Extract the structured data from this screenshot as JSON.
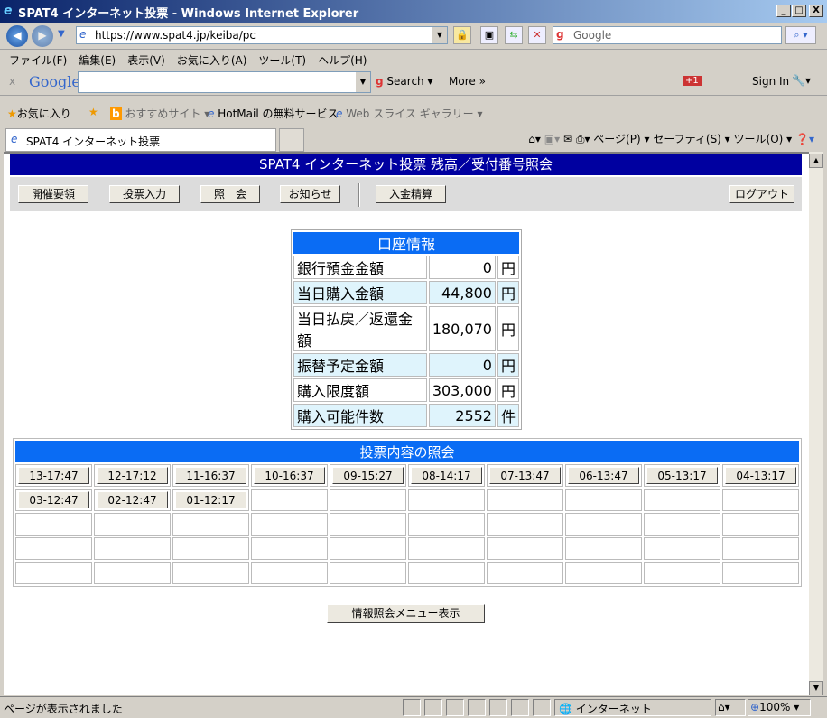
{
  "window": {
    "title": "SPAT4 インターネット投票 - Windows Internet Explorer",
    "minimize": "_",
    "maximize": "□",
    "close": "X"
  },
  "nav": {
    "url": "https://www.spat4.jp/keiba/pc",
    "search_placeholder": "Google"
  },
  "menu": [
    "ファイル(F)",
    "編集(E)",
    "表示(V)",
    "お気に入り(A)",
    "ツール(T)",
    "ヘルプ(H)"
  ],
  "google_bar": {
    "close": "x",
    "logo": "Google",
    "search": "Search",
    "more": "More »",
    "gplus": "+1",
    "sign_in": "Sign In"
  },
  "favorites": {
    "label": "お気に入り",
    "items": [
      "おすすめサイト ▾",
      "HotMail の無料サービス",
      "Web スライス ギャラリー ▾"
    ]
  },
  "tab": {
    "title": "SPAT4 インターネット投票"
  },
  "commands": {
    "page": "ページ(P) ▾",
    "safety": "セーフティ(S) ▾",
    "tools": "ツール(O) ▾"
  },
  "page": {
    "header": "SPAT4 インターネット投票 残高／受付番号照会",
    "nav_buttons": [
      "開催要領",
      "投票入力",
      "照　会",
      "お知らせ",
      "入金精算"
    ],
    "logout": "ログアウト",
    "account": {
      "title": "口座情報",
      "rows": [
        {
          "label": "銀行預金金額",
          "value": "0",
          "unit": "円"
        },
        {
          "label": "当日購入金額",
          "value": "44,800",
          "unit": "円"
        },
        {
          "label": "当日払戻／返還金額",
          "value": "180,070",
          "unit": "円"
        },
        {
          "label": "振替予定金額",
          "value": "0",
          "unit": "円"
        },
        {
          "label": "購入限度額",
          "value": "303,000",
          "unit": "円"
        },
        {
          "label": "購入可能件数",
          "value": "2552",
          "unit": "件"
        }
      ]
    },
    "votes": {
      "title": "投票内容の照会",
      "items": [
        "13-17:47",
        "12-17:12",
        "11-16:37",
        "10-16:37",
        "09-15:27",
        "08-14:17",
        "07-13:47",
        "06-13:47",
        "05-13:17",
        "04-13:17",
        "03-12:47",
        "02-12:47",
        "01-12:17"
      ]
    },
    "menu_button": "情報照会メニュー表示"
  },
  "status": {
    "text": "ページが表示されました",
    "zone": "インターネット",
    "zoom": "100%"
  }
}
